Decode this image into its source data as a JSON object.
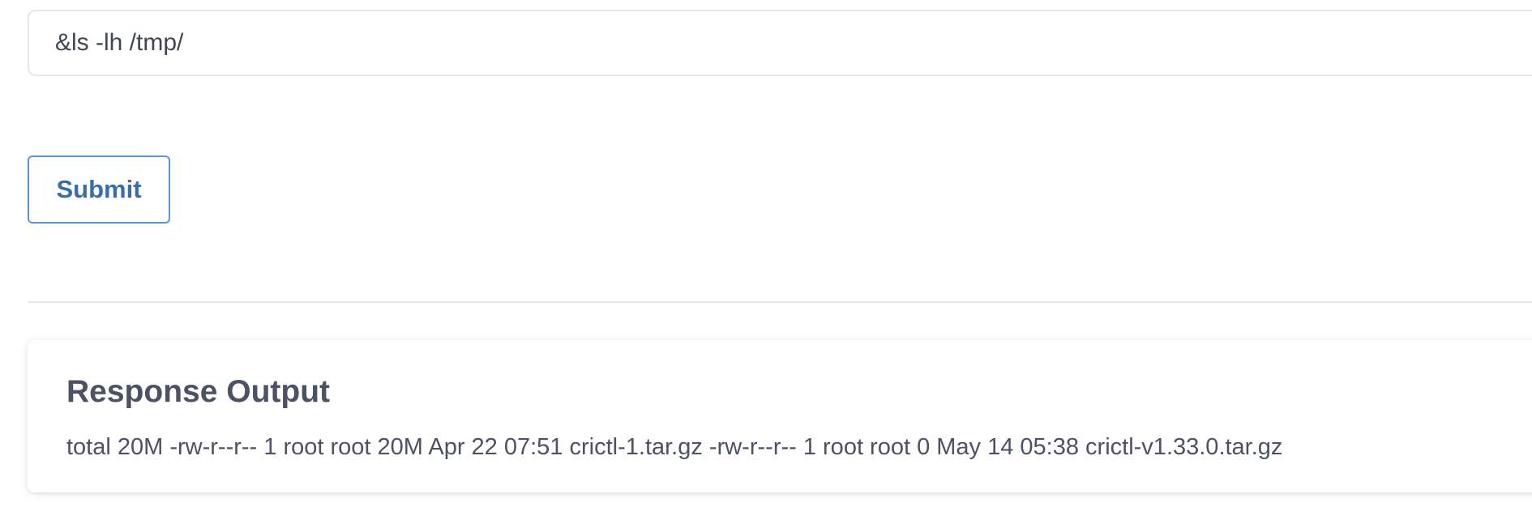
{
  "command_input": {
    "value": "&ls -lh /tmp/"
  },
  "submit": {
    "label": "Submit"
  },
  "response": {
    "title": "Response Output",
    "text": "total 20M -rw-r--r-- 1 root root 20M Apr 22 07:51 crictl-1.tar.gz -rw-r--r-- 1 root root 0 May 14 05:38 crictl-v1.33.0.tar.gz"
  },
  "colors": {
    "accent": "#3a6ea8",
    "button_border": "#5a95d4",
    "text": "#4a5263",
    "border": "#e3e6ec"
  }
}
